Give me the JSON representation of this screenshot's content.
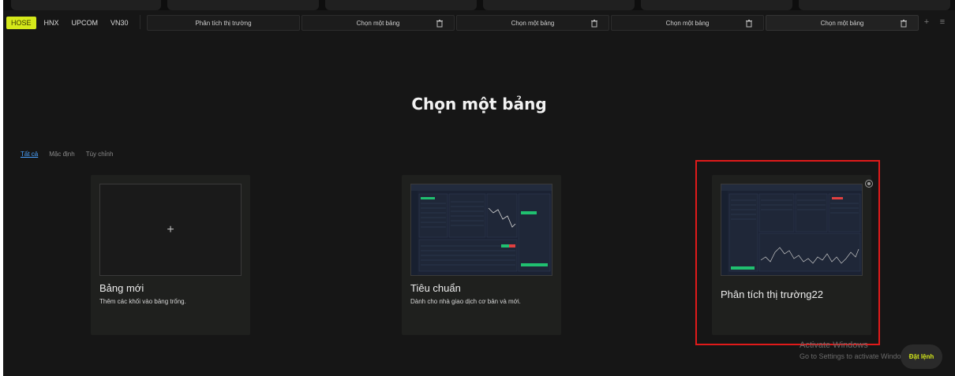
{
  "exchanges": [
    "HOSE",
    "HNX",
    "UPCOM",
    "VN30"
  ],
  "active_exchange": "HOSE",
  "tabs": [
    {
      "label": "Phân tích thị trường"
    },
    {
      "label": "Chọn một bảng"
    },
    {
      "label": "Chọn một bảng"
    },
    {
      "label": "Chọn một bảng"
    },
    {
      "label": "Chọn một bảng"
    }
  ],
  "toolbar": {
    "add_icon": "plus-icon",
    "menu_icon": "hamburger-menu-icon"
  },
  "page_title": "Chọn một bảng",
  "filters": [
    {
      "label": "Tất cả",
      "active": true
    },
    {
      "label": "Mặc định",
      "active": false
    },
    {
      "label": "Tùy chỉnh",
      "active": false
    }
  ],
  "cards": [
    {
      "name": "Bảng mới",
      "description": "Thêm các khối vào bảng trống."
    },
    {
      "name": "Tiêu chuẩn",
      "description": "Dành cho nhà giao dịch cơ bản và mới."
    },
    {
      "name": "Phân tích thị trường22",
      "description": ""
    }
  ],
  "watermark": {
    "line1": "Activate Windows",
    "line2": "Go to Settings to activate Windo"
  },
  "order_button": "Đặt lệnh",
  "colors": {
    "accent": "#d4e81a",
    "link": "#4aa3ff",
    "highlight": "#e01a1a",
    "background": "#161616"
  }
}
